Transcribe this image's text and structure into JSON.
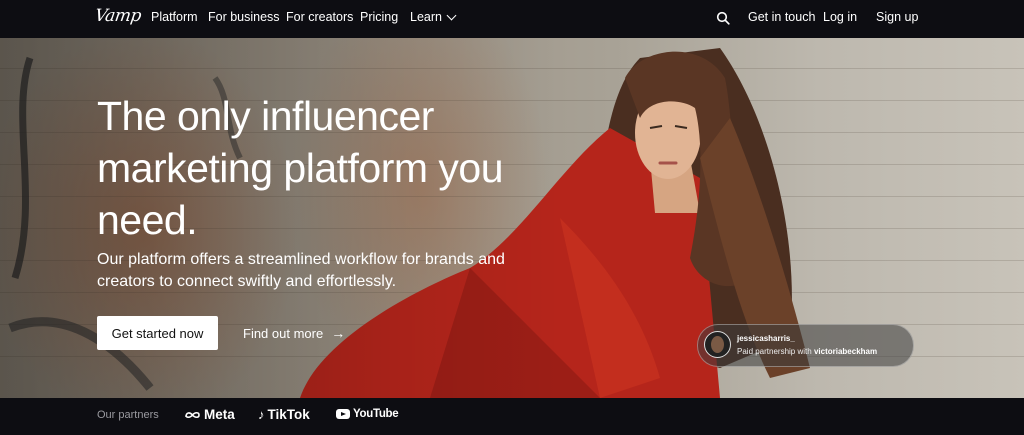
{
  "brand": {
    "logo_text": "Vamp"
  },
  "nav": {
    "items": [
      {
        "label": "Platform"
      },
      {
        "label": "For business"
      },
      {
        "label": "For creators"
      },
      {
        "label": "Pricing"
      },
      {
        "label": "Learn"
      }
    ],
    "right": [
      {
        "label": "Get in touch"
      },
      {
        "label": "Log in"
      },
      {
        "label": "Sign up"
      }
    ]
  },
  "hero": {
    "headline": "The only influencer marketing platform you need.",
    "subtext": "Our platform offers a streamlined workflow for brands and creators to connect swiftly and effortlessly.",
    "cta_label": "Get started now",
    "secondary_label": "Find out more",
    "secondary_arrow": "→"
  },
  "creator_tag": {
    "username": "jessicasharris_",
    "partnership_prefix": "Paid partnership with",
    "partner": "victoriabeckham"
  },
  "partners": {
    "label": "Our partners",
    "logos": [
      {
        "name": "Meta",
        "icon": "meta-infinity-icon"
      },
      {
        "name": "TikTok",
        "icon": "tiktok-note-icon"
      },
      {
        "name": "YouTube",
        "icon": "youtube-play-icon"
      }
    ]
  },
  "colors": {
    "nav_bg": "#0d0d12",
    "jacket": "#b5251b",
    "cta_bg": "#ffffff"
  }
}
